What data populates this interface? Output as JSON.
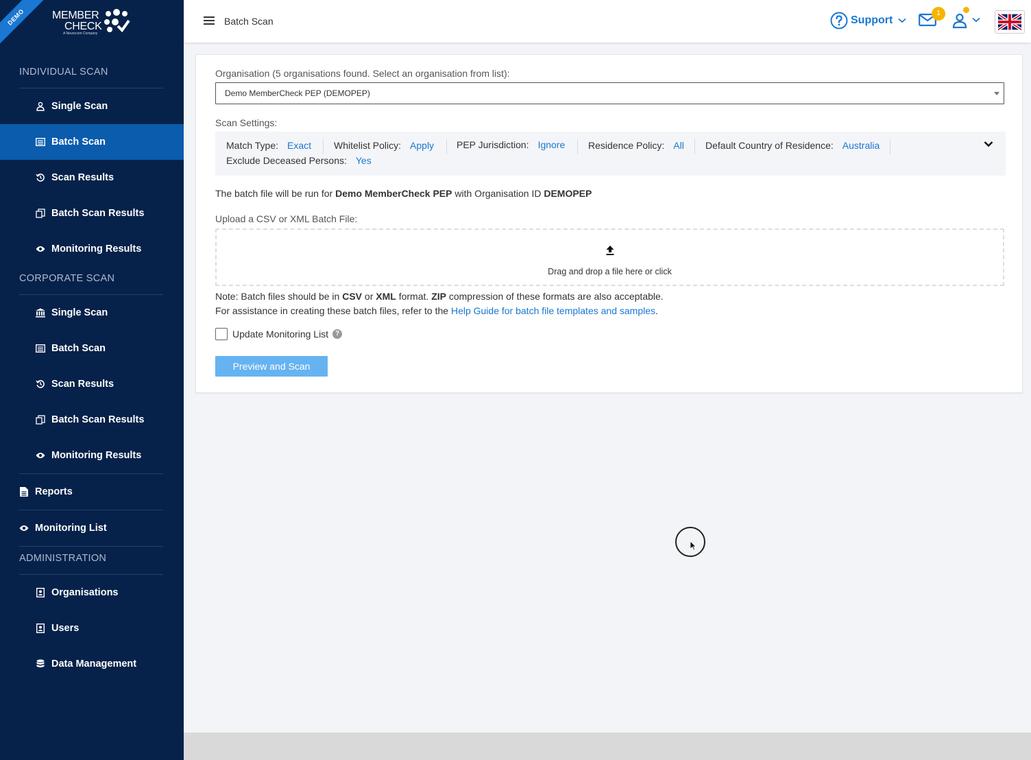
{
  "brand": {
    "demo_ribbon": "DEMO",
    "logo_line1": "MEMBER",
    "logo_line2": "CHECK",
    "logo_sub": "A Neurocom Company"
  },
  "sidebar": {
    "sections": [
      {
        "title": "INDIVIDUAL SCAN"
      },
      {
        "title": "CORPORATE SCAN"
      },
      {
        "title": "ADMINISTRATION"
      }
    ],
    "individual": [
      {
        "label": "Single Scan",
        "icon": "person-outline-icon"
      },
      {
        "label": "Batch Scan",
        "icon": "list-card-icon"
      },
      {
        "label": "Scan Results",
        "icon": "history-icon"
      },
      {
        "label": "Batch Scan Results",
        "icon": "copy-results-icon"
      },
      {
        "label": "Monitoring Results",
        "icon": "eye-icon"
      }
    ],
    "corporate": [
      {
        "label": "Single Scan",
        "icon": "bank-icon"
      },
      {
        "label": "Batch Scan",
        "icon": "list-card-icon"
      },
      {
        "label": "Scan Results",
        "icon": "history-icon"
      },
      {
        "label": "Batch Scan Results",
        "icon": "copy-results-icon"
      },
      {
        "label": "Monitoring Results",
        "icon": "eye-icon"
      }
    ],
    "reports": {
      "label": "Reports",
      "icon": "document-icon"
    },
    "monitoring_list": {
      "label": "Monitoring List",
      "icon": "eye-icon"
    },
    "administration": [
      {
        "label": "Organisations",
        "icon": "org-badge-icon"
      },
      {
        "label": "Users",
        "icon": "user-badge-icon"
      },
      {
        "label": "Data Management",
        "icon": "database-icon"
      }
    ],
    "active_item": "individual.Batch Scan"
  },
  "header": {
    "title": "Batch Scan",
    "support_label": "Support",
    "mail_badge": "1",
    "language": "English (UK)"
  },
  "form": {
    "org_label": "Organisation (5 organisations found. Select an organisation from list):",
    "org_selected": "Demo MemberCheck PEP (DEMOPEP)",
    "scan_settings_label": "Scan Settings:",
    "settings": {
      "match_type": {
        "key": "Match Type:",
        "value": "Exact"
      },
      "whitelist": {
        "key": "Whitelist Policy:",
        "value": "Apply"
      },
      "pep_jurisdiction": {
        "key": "PEP Jurisdiction:",
        "value": "Ignore"
      },
      "residence": {
        "key": "Residence Policy:",
        "value": "All"
      },
      "default_country": {
        "key": "Default Country of Residence:",
        "value": "Australia"
      },
      "exclude_deceased": {
        "key": "Exclude Deceased Persons:",
        "value": "Yes"
      }
    },
    "info": {
      "prefix": "The batch file will be run for ",
      "org_name": "Demo MemberCheck PEP",
      "middle": " with Organisation ID ",
      "org_id": "DEMOPEP"
    },
    "upload_label": "Upload a CSV or XML Batch File:",
    "dropzone_text": "Drag and drop a file here or click",
    "note1": {
      "p1": "Note: Batch files should be in ",
      "csv": "CSV",
      "p2": " or ",
      "xml": "XML",
      "p3": " format. ",
      "zip": "ZIP",
      "p4": " compression of these formats are also acceptable."
    },
    "note2": {
      "p1": "For assistance in creating these batch files, refer to the ",
      "link": "Help Guide for batch file templates and samples",
      "p2": "."
    },
    "update_monitoring_label": "Update Monitoring List",
    "update_monitoring_checked": false,
    "help_glyph": "?",
    "submit_label": "Preview and Scan"
  },
  "colors": {
    "sidebar_bg": "#06224a",
    "active_bg": "#0b5cad",
    "accent": "#1a77d2",
    "button": "#66b3f1",
    "badge": "#f5b400"
  }
}
